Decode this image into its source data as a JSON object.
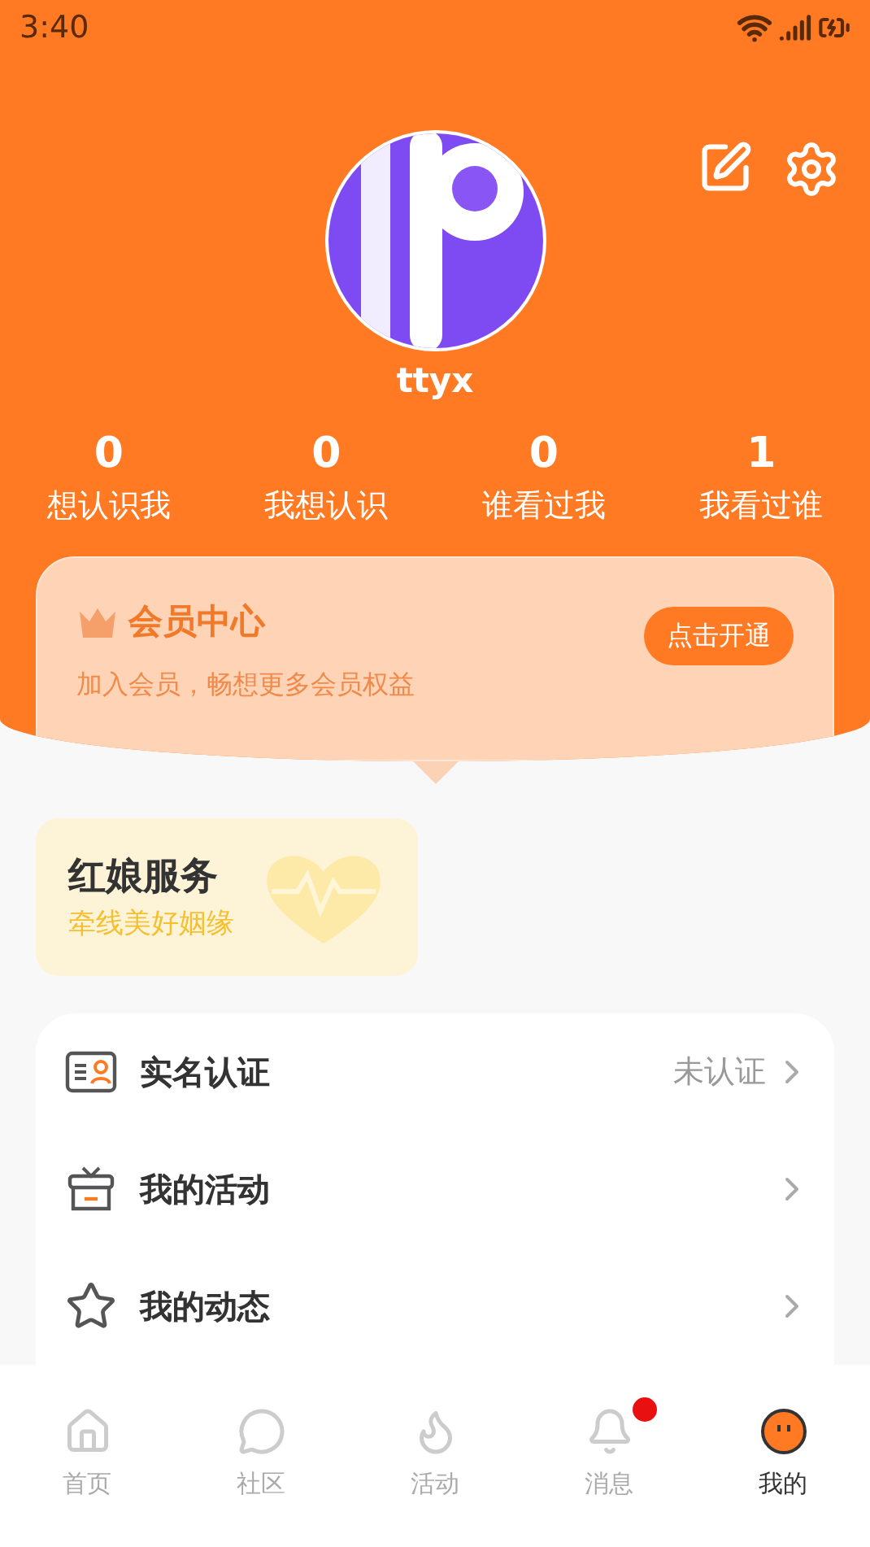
{
  "status_bar": {
    "time": "3:40"
  },
  "profile": {
    "name": "ttyx"
  },
  "stats": [
    {
      "value": "0",
      "label": "想认识我"
    },
    {
      "value": "0",
      "label": "我想认识"
    },
    {
      "value": "0",
      "label": "谁看过我"
    },
    {
      "value": "1",
      "label": "我看过谁"
    }
  ],
  "vip": {
    "title": "会员中心",
    "subtitle": "加入会员，畅想更多会员权益",
    "button": "点击开通"
  },
  "matchmaker": {
    "title": "红娘服务",
    "subtitle": "牵线美好姻缘"
  },
  "menu": [
    {
      "kind": "id",
      "label": "实名认证",
      "value": "未认证"
    },
    {
      "kind": "gift",
      "label": "我的活动"
    },
    {
      "kind": "star",
      "label": "我的动态"
    }
  ],
  "tabs": [
    {
      "kind": "home",
      "label": "首页",
      "selected": false,
      "dot": false
    },
    {
      "kind": "chat",
      "label": "社区",
      "selected": false,
      "dot": false
    },
    {
      "kind": "flame",
      "label": "活动",
      "selected": false,
      "dot": false
    },
    {
      "kind": "bell",
      "label": "消息",
      "selected": false,
      "dot": true
    },
    {
      "kind": "me",
      "label": "我的",
      "selected": true,
      "dot": false
    }
  ]
}
